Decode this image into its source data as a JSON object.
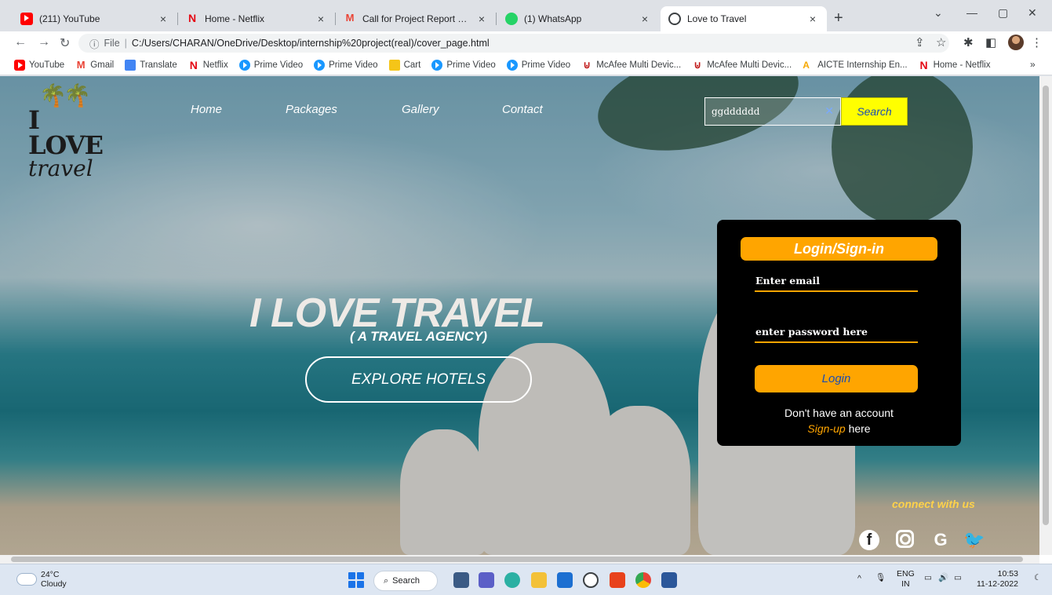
{
  "browser": {
    "tabs": [
      {
        "title": "(211) YouTube",
        "icon": "youtube-icon"
      },
      {
        "title": "Home - Netflix",
        "icon": "netflix-icon"
      },
      {
        "title": "Call for Project Report Submission",
        "icon": "gmail-icon"
      },
      {
        "title": "(1) WhatsApp",
        "icon": "whatsapp-icon"
      },
      {
        "title": "Love to Travel",
        "icon": "globe-icon"
      }
    ],
    "close_glyph": "×",
    "new_tab_glyph": "+",
    "address": {
      "scheme_label": "File",
      "url": "C:/Users/CHARAN/OneDrive/Desktop/internship%20project(real)/cover_page.html"
    },
    "bookmarks": [
      {
        "label": "YouTube",
        "icon": "youtube-icon"
      },
      {
        "label": "Gmail",
        "icon": "gmail-icon"
      },
      {
        "label": "Translate",
        "icon": "translate-icon"
      },
      {
        "label": "Netflix",
        "icon": "netflix-icon"
      },
      {
        "label": "Prime Video",
        "icon": "prime-video-icon"
      },
      {
        "label": "Prime Video",
        "icon": "prime-video-icon"
      },
      {
        "label": "Cart",
        "icon": "cart-icon"
      },
      {
        "label": "Prime Video",
        "icon": "prime-video-icon"
      },
      {
        "label": "Prime Video",
        "icon": "prime-video-icon"
      },
      {
        "label": "McAfee Multi Devic...",
        "icon": "mcafee-icon"
      },
      {
        "label": "McAfee Multi Devic...",
        "icon": "mcafee-icon"
      },
      {
        "label": "AICTE Internship En...",
        "icon": "aicte-icon"
      },
      {
        "label": "Home - Netflix",
        "icon": "netflix-icon"
      }
    ],
    "bookmarks_more": "»"
  },
  "page": {
    "nav": [
      "Home",
      "Packages",
      "Gallery",
      "Contact"
    ],
    "search": {
      "value": "ggdddddd",
      "button_label": "Search"
    },
    "hero": {
      "title": "I LOVE TRAVEL",
      "subtitle": "( A TRAVEL AGENCY)",
      "cta_label": "EXPLORE HOTELS"
    },
    "login": {
      "heading": "Login/Sign-in",
      "email_placeholder": "Enter email",
      "password_placeholder": "enter password here",
      "button_label": "Login",
      "no_account_text": "Don't have an account",
      "signup_link": "Sign-up",
      "signup_suffix": "here"
    },
    "connect_label": "connect with us",
    "social": [
      "facebook-icon",
      "instagram-icon",
      "google-icon",
      "twitter-icon"
    ]
  },
  "taskbar": {
    "weather": {
      "temp": "24°C",
      "condition": "Cloudy"
    },
    "search_label": "Search",
    "lang": {
      "line1": "ENG",
      "line2": "IN"
    },
    "clock": {
      "time": "10:53",
      "date": "11-12-2022"
    }
  },
  "colors": {
    "accent_orange": "#ffa500",
    "search_yellow": "#ffff00",
    "link_blue": "#1a4db3"
  }
}
